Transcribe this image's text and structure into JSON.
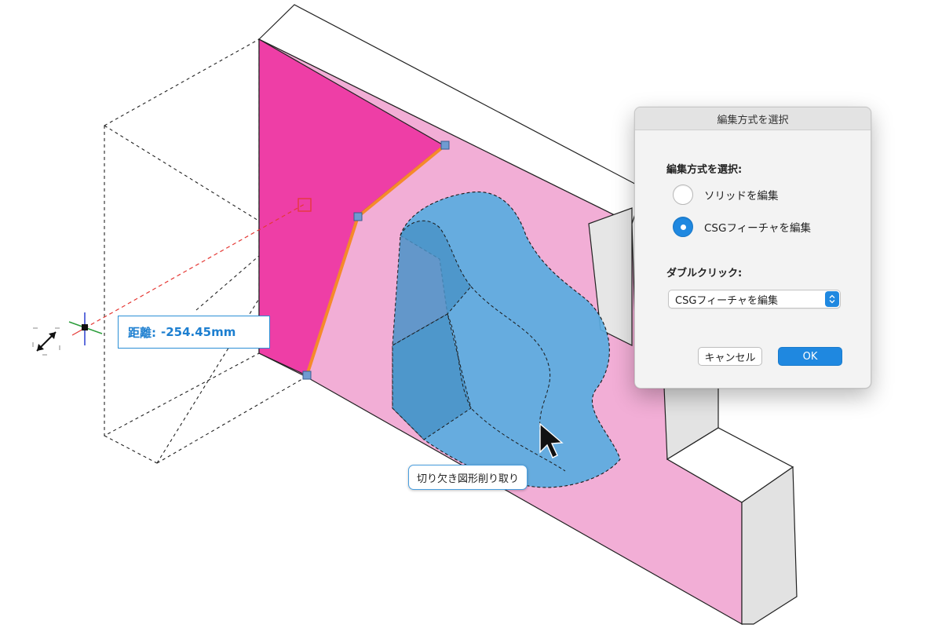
{
  "viewport": {
    "dimension_label": {
      "prefix": "距離:",
      "value": "-254.45mm"
    },
    "tooltip": "切り欠き図形削り取り",
    "icons": {
      "scale_handle": "diagonal-resize-icon",
      "cursor": "arrow-pointer-icon"
    }
  },
  "dialog": {
    "title": "編集方式を選択",
    "section_label": "編集方式を選択:",
    "options": [
      {
        "label": "ソリッドを編集",
        "checked": false
      },
      {
        "label": "CSGフィーチャを編集",
        "checked": true
      }
    ],
    "double_click_label": "ダブルクリック:",
    "double_click_value": "CSGフィーチャを編集",
    "cancel_label": "キャンセル",
    "ok_label": "OK"
  },
  "colors": {
    "magenta_face": "#ee3ea6",
    "pink_face": "#f2aed6",
    "cut_blue": "#5aabe0",
    "accent_blue": "#1f88e0",
    "edge_orange": "#f58a2b"
  }
}
